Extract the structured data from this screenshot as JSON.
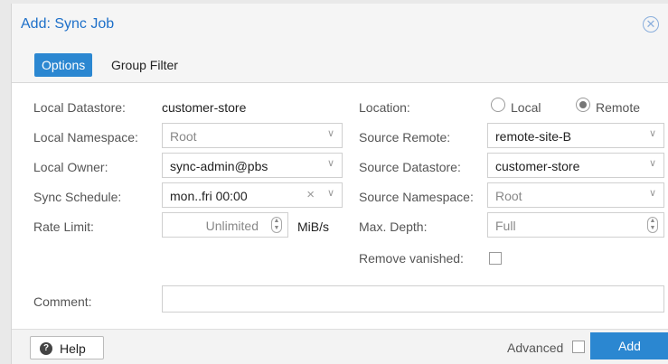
{
  "window": {
    "title": "Add: Sync Job",
    "close_icon": "close-icon"
  },
  "tabs": [
    {
      "label": "Options",
      "active": true
    },
    {
      "label": "Group Filter",
      "active": false
    }
  ],
  "left": {
    "local_datastore": {
      "label": "Local Datastore:",
      "value": "customer-store"
    },
    "local_namespace": {
      "label": "Local Namespace:",
      "value": "Root"
    },
    "local_owner": {
      "label": "Local Owner:",
      "value": "sync-admin@pbs"
    },
    "sync_schedule": {
      "label": "Sync Schedule:",
      "value": "mon..fri 00:00"
    },
    "rate_limit": {
      "label": "Rate Limit:",
      "value": "Unlimited",
      "unit": "MiB/s"
    }
  },
  "right": {
    "location": {
      "label": "Location:",
      "options": [
        "Local",
        "Remote"
      ],
      "selected": "Remote"
    },
    "source_remote": {
      "label": "Source Remote:",
      "value": "remote-site-B"
    },
    "source_datastore": {
      "label": "Source Datastore:",
      "value": "customer-store"
    },
    "source_namespace": {
      "label": "Source Namespace:",
      "value": "Root"
    },
    "max_depth": {
      "label": "Max. Depth:",
      "value": "Full"
    },
    "remove_vanished": {
      "label": "Remove vanished:",
      "checked": false
    }
  },
  "comment": {
    "label": "Comment:",
    "value": ""
  },
  "footer": {
    "help_label": "Help",
    "advanced_label": "Advanced",
    "advanced_checked": false,
    "add_label": "Add"
  },
  "colors": {
    "accent": "#2b87d1",
    "title": "#1e70c9"
  }
}
